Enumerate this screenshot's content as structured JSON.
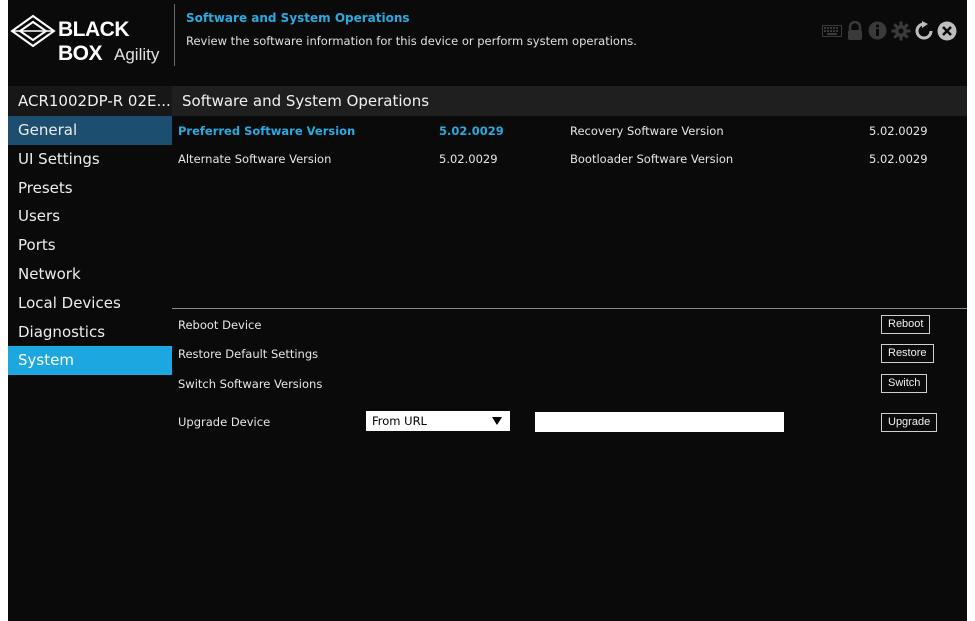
{
  "header": {
    "brand": "BLACK BOX",
    "product": "Agility",
    "title": "Software and System Operations",
    "description": "Review the software information for this device or perform system operations.",
    "toolbar_icons": [
      "keyboard-icon",
      "lock-icon",
      "info-icon",
      "gear-icon",
      "refresh-icon",
      "close-icon"
    ]
  },
  "device": {
    "name": "ACR1002DP-R 02E..."
  },
  "section": {
    "title": "Software and System Operations"
  },
  "sidebar": {
    "items": [
      {
        "label": "General"
      },
      {
        "label": "UI Settings"
      },
      {
        "label": "Presets"
      },
      {
        "label": "Users"
      },
      {
        "label": "Ports"
      },
      {
        "label": "Network"
      },
      {
        "label": "Local Devices"
      },
      {
        "label": "Diagnostics"
      },
      {
        "label": "System"
      }
    ],
    "active": "System"
  },
  "versions": {
    "preferred_label": "Preferred Software Version",
    "preferred_value": "5.02.0029",
    "alternate_label": "Alternate Software Version",
    "alternate_value": "5.02.0029",
    "recovery_label": "Recovery Software Version",
    "recovery_value": "5.02.0029",
    "bootloader_label": "Bootloader Software Version",
    "bootloader_value": "5.02.0029"
  },
  "operations": {
    "reboot_label": "Reboot Device",
    "reboot_button": "Reboot",
    "restore_label": "Restore Default Settings",
    "restore_button": "Restore",
    "switch_label": "Switch Software Versions",
    "switch_button": "Switch",
    "upgrade_label": "Upgrade Device",
    "upgrade_source": "From URL",
    "upgrade_url_value": "",
    "upgrade_button": "Upgrade"
  },
  "colors": {
    "accent": "#29abe2",
    "active_nav": "#1da7e0",
    "general_nav": "#1c4f6f",
    "background": "#0a0a0a"
  }
}
